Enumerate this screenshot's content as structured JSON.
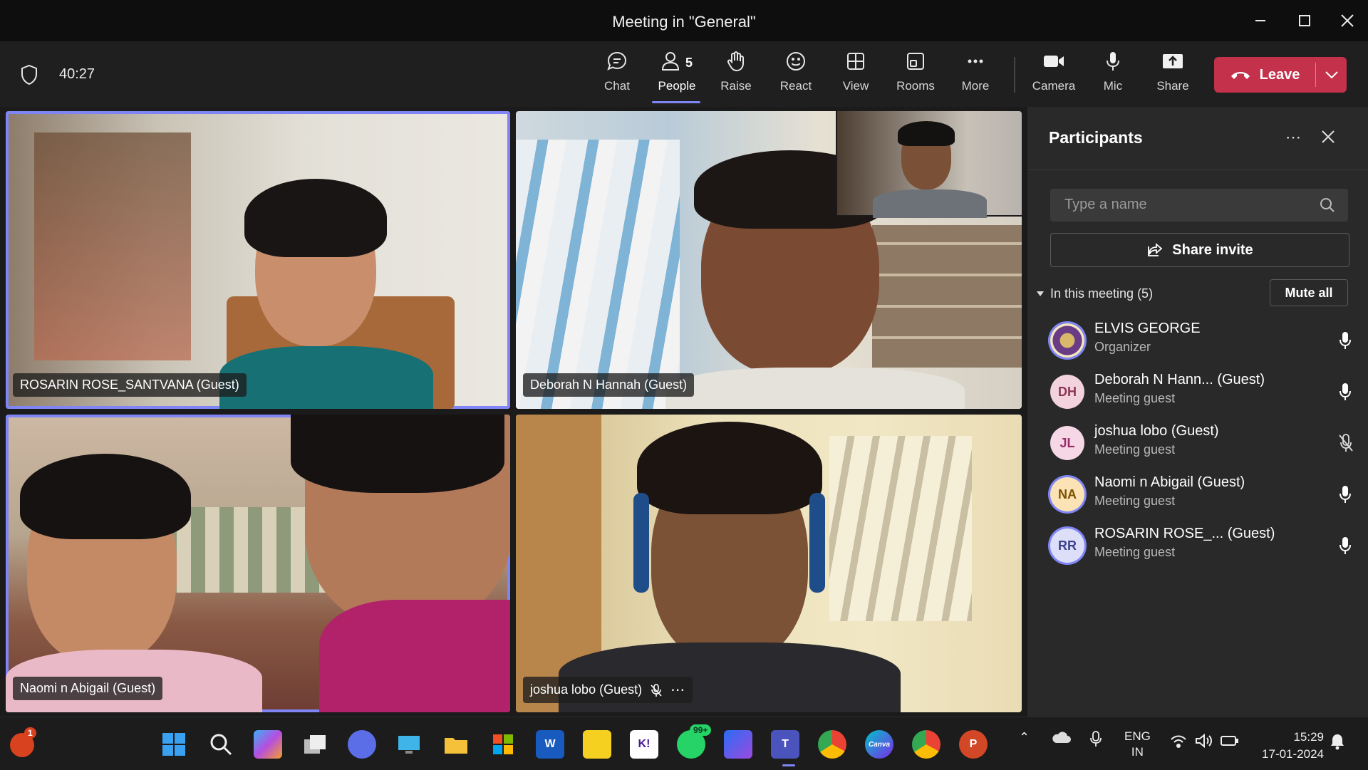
{
  "window": {
    "title": "Meeting in \"General\""
  },
  "toolbar": {
    "timer": "40:27",
    "buttons": {
      "chat": "Chat",
      "people": "People",
      "people_count": "5",
      "raise": "Raise",
      "react": "React",
      "view": "View",
      "rooms": "Rooms",
      "more": "More",
      "camera": "Camera",
      "mic": "Mic",
      "share": "Share"
    },
    "leave": "Leave"
  },
  "video": {
    "tiles": [
      {
        "name": "ROSARIN ROSE_SANTVANA (Guest)",
        "selected": true
      },
      {
        "name": "Deborah N Hannah (Guest)",
        "selected": false
      },
      {
        "name": "Naomi n Abigail (Guest)",
        "selected": true
      },
      {
        "name": "joshua lobo (Guest)",
        "selected": false,
        "muted": true
      }
    ]
  },
  "panel": {
    "title": "Participants",
    "search_placeholder": "Type a name",
    "share_invite": "Share invite",
    "section": "In this meeting (5)",
    "mute_all": "Mute all",
    "participants": [
      {
        "initials": "",
        "name": "ELVIS GEORGE",
        "role": "Organizer",
        "muted": false
      },
      {
        "initials": "DH",
        "name": "Deborah N Hann... (Guest)",
        "role": "Meeting guest",
        "muted": false,
        "color": "#f2d3dd",
        "text": "#8a3556"
      },
      {
        "initials": "JL",
        "name": "joshua lobo (Guest)",
        "role": "Meeting guest",
        "muted": true,
        "color": "#f5d7e6",
        "text": "#9b2c6a"
      },
      {
        "initials": "NA",
        "name": "Naomi n Abigail (Guest)",
        "role": "Meeting guest",
        "muted": false,
        "color": "#fbe3b5",
        "text": "#7a5200"
      },
      {
        "initials": "RR",
        "name": "ROSARIN ROSE_... (Guest)",
        "role": "Meeting guest",
        "muted": false,
        "color": "#dcdff7",
        "text": "#3d428c"
      }
    ]
  },
  "taskbar": {
    "notification_badge": "1",
    "whatsapp_badge": "99+",
    "language": "ENG",
    "region": "IN",
    "time": "15:29",
    "date": "17-01-2024",
    "apps": [
      "start-icon",
      "search-icon",
      "copilot-icon",
      "task-view-icon",
      "zoom-icon",
      "desktop-icon",
      "file-explorer-icon",
      "store-icon",
      "word-icon",
      "sticky-notes-icon",
      "kahoot-icon",
      "whatsapp-icon",
      "pen-icon",
      "teams-icon",
      "chrome-icon",
      "canva-icon",
      "chrome-profile-icon",
      "powerpoint-icon"
    ],
    "labels": {
      "word": "W",
      "kahoot": "K!",
      "powerpoint": "P",
      "canva": "Canva"
    }
  },
  "colors": {
    "accent": "#7f85f5",
    "leave": "#c4314b"
  }
}
